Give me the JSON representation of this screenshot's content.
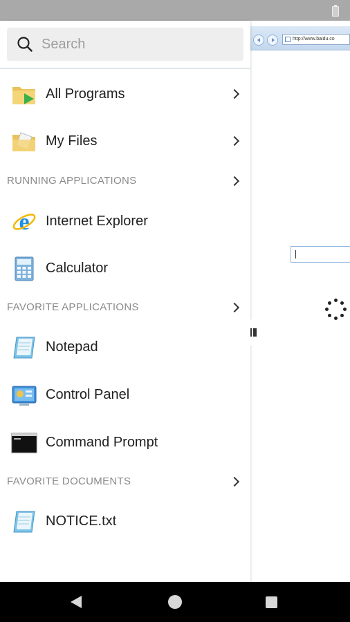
{
  "search": {
    "placeholder": "Search"
  },
  "items": {
    "all_programs": "All Programs",
    "my_files": "My Files",
    "internet_explorer": "Internet Explorer",
    "calculator": "Calculator",
    "notepad": "Notepad",
    "control_panel": "Control Panel",
    "command_prompt": "Command Prompt",
    "notice_txt": "NOTICE.txt"
  },
  "sections": {
    "running": "RUNNING APPLICATIONS",
    "favorite_apps": "FAVORITE APPLICATIONS",
    "favorite_docs": "FAVORITE DOCUMENTS"
  },
  "browser": {
    "address": "http://www.baidu.co"
  },
  "icons": {
    "folder": "folder-programs-icon",
    "files": "my-files-icon",
    "ie": "internet-explorer-icon",
    "calculator": "calculator-icon",
    "notepad": "notepad-icon",
    "control_panel": "control-panel-icon",
    "command_prompt": "command-prompt-icon",
    "document": "text-document-icon"
  }
}
